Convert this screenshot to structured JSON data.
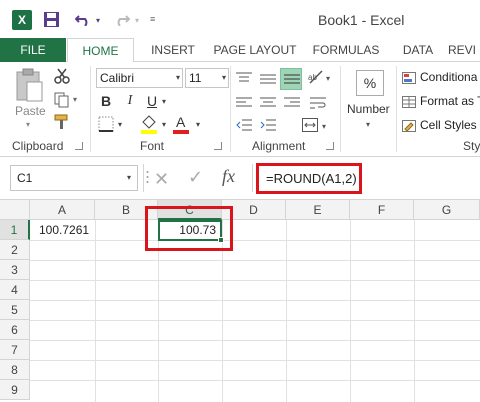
{
  "app": {
    "title": "Book1 - Excel",
    "logo_letter": "X",
    "accent_color": "#217346",
    "highlight_color": "#d9151b"
  },
  "ribbon_tabs": [
    "FILE",
    "HOME",
    "INSERT",
    "PAGE LAYOUT",
    "FORMULAS",
    "DATA",
    "REVI"
  ],
  "ribbon": {
    "clipboard": {
      "label": "Clipboard",
      "paste_label": "Paste"
    },
    "font": {
      "label": "Font",
      "font_name": "Calibri",
      "font_size": "11",
      "bold": "B",
      "italic": "I",
      "underline": "U"
    },
    "alignment": {
      "label": "Alignment"
    },
    "number": {
      "label": "Number",
      "percent": "%"
    },
    "styles": {
      "label": "Sty",
      "items": [
        "Conditiona",
        "Format as T",
        "Cell Styles"
      ]
    }
  },
  "formula_bar": {
    "name_box": "C1",
    "fx": "fx",
    "formula": "=ROUND(A1,2)"
  },
  "sheet": {
    "columns": [
      "A",
      "B",
      "C",
      "D",
      "E",
      "F",
      "G"
    ],
    "rows": [
      "1",
      "2",
      "3",
      "4",
      "5",
      "6",
      "7",
      "8",
      "9"
    ],
    "active_column": "C",
    "active_row": "1",
    "cells": {
      "A1": "100.7261",
      "C1": "100.73"
    }
  }
}
